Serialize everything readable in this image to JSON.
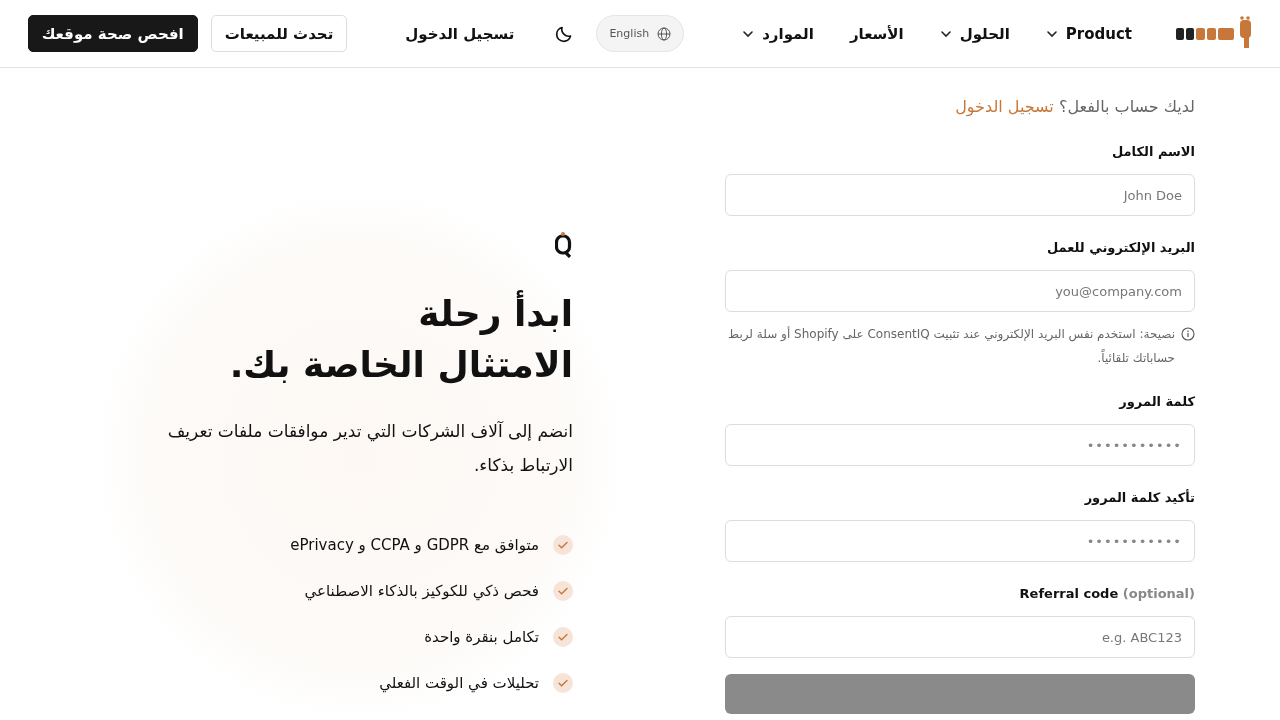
{
  "header": {
    "nav": [
      {
        "label": "Product",
        "dropdown": true
      },
      {
        "label": "الحلول",
        "dropdown": true
      },
      {
        "label": "الأسعار",
        "dropdown": false
      },
      {
        "label": "الموارد",
        "dropdown": true
      }
    ],
    "language": "English",
    "login": "تسجيل الدخول",
    "buttons": [
      {
        "label": "تحدث للمبيعات",
        "kind": "outline"
      },
      {
        "label": "افحص صحة موقعك",
        "kind": "primary"
      }
    ]
  },
  "form": {
    "subtitle": "لديك حساب بالفعل؟",
    "subtitle_link": "تسجيل الدخول",
    "fields": [
      {
        "label": "الاسم الكامل",
        "placeholder": "John Doe"
      },
      {
        "label": "البريد الإلكتروني للعمل",
        "placeholder": "you@company.com",
        "hint": "نصيحة: استخدم نفس البريد الإلكتروني عند تثبيت ConsentIQ على Shopify أو سلة لربط حساباتك تلقائياً."
      },
      {
        "label": "كلمة المرور",
        "value": "•••••••••••"
      },
      {
        "label": "تأكيد كلمة المرور",
        "value": "•••••••••••"
      },
      {
        "label": "Referral code",
        "optional": "(optional)",
        "placeholder": "e.g. ABC123"
      }
    ],
    "submit": {
      "disabled": true
    }
  },
  "hero": {
    "heading": [
      "ابدأ رحلة",
      "الامتثال الخاصة بك."
    ],
    "text": "انضم إلى آلاف الشركات التي تدير موافقات ملفات تعريف الارتباط بذكاء.",
    "features": [
      "متوافق مع GDPR و CCPA و ePrivacy",
      "فحص ذكي للكوكيز بالذكاء الاصطناعي",
      "تكامل بنقرة واحدة",
      "تحليلات في الوقت الفعلي"
    ]
  }
}
